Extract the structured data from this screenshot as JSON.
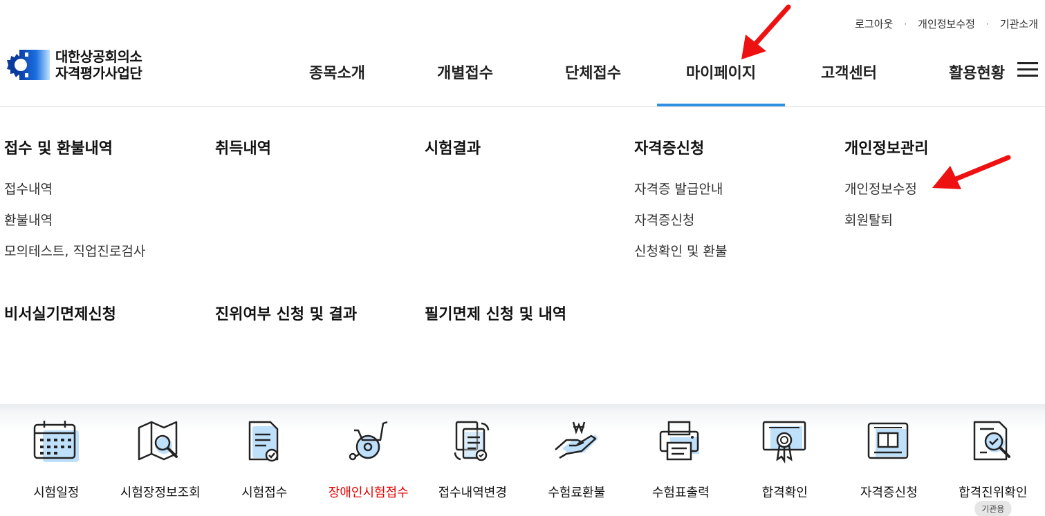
{
  "util_links": [
    "로그아웃",
    "개인정보수정",
    "기관소개"
  ],
  "util_sep": "·",
  "logo": {
    "line1": "대한상공회의소",
    "line2": "자격평가사업단"
  },
  "gnb": [
    "종목소개",
    "개별접수",
    "단체접수",
    "마이페이지",
    "고객센터",
    "활용현황"
  ],
  "gnb_active": "마이페이지",
  "mega": {
    "col1": {
      "title": "접수 및 환불내역",
      "items": [
        "접수내역",
        "환불내역",
        "모의테스트, 직업진로검사"
      ]
    },
    "col2": {
      "title": "취득내역"
    },
    "col3": {
      "title": "시험결과"
    },
    "col4": {
      "title": "자격증신청",
      "items": [
        "자격증 발급안내",
        "자격증신청",
        "신청확인 및 환불"
      ]
    },
    "col5": {
      "title": "개인정보관리",
      "items": [
        "개인정보수정",
        "회원탈퇴"
      ]
    },
    "row2": [
      "비서실기면제신청",
      "진위여부 신청 및 결과",
      "필기면제 신청 및 내역"
    ]
  },
  "quick": [
    {
      "label": "시험일정",
      "icon": "calendar-icon"
    },
    {
      "label": "시험장정보조회",
      "icon": "map-search-icon"
    },
    {
      "label": "시험접수",
      "icon": "document-check-icon"
    },
    {
      "label": "장애인시험접수",
      "icon": "wheelchair-icon",
      "color": "#e60000"
    },
    {
      "label": "접수내역변경",
      "icon": "documents-refresh-icon"
    },
    {
      "label": "수험료환불",
      "icon": "hand-won-icon"
    },
    {
      "label": "수험표출력",
      "icon": "printer-icon"
    },
    {
      "label": "합격확인",
      "icon": "certificate-medal-icon"
    },
    {
      "label": "자격증신청",
      "icon": "id-card-icon"
    },
    {
      "label": "합격진위확인",
      "icon": "document-magnifier-icon",
      "badge": "기관용"
    }
  ],
  "colors": {
    "accent": "#2f8fe0",
    "arrow": "#ee1111",
    "icon_fill": "#bfe0fb"
  }
}
